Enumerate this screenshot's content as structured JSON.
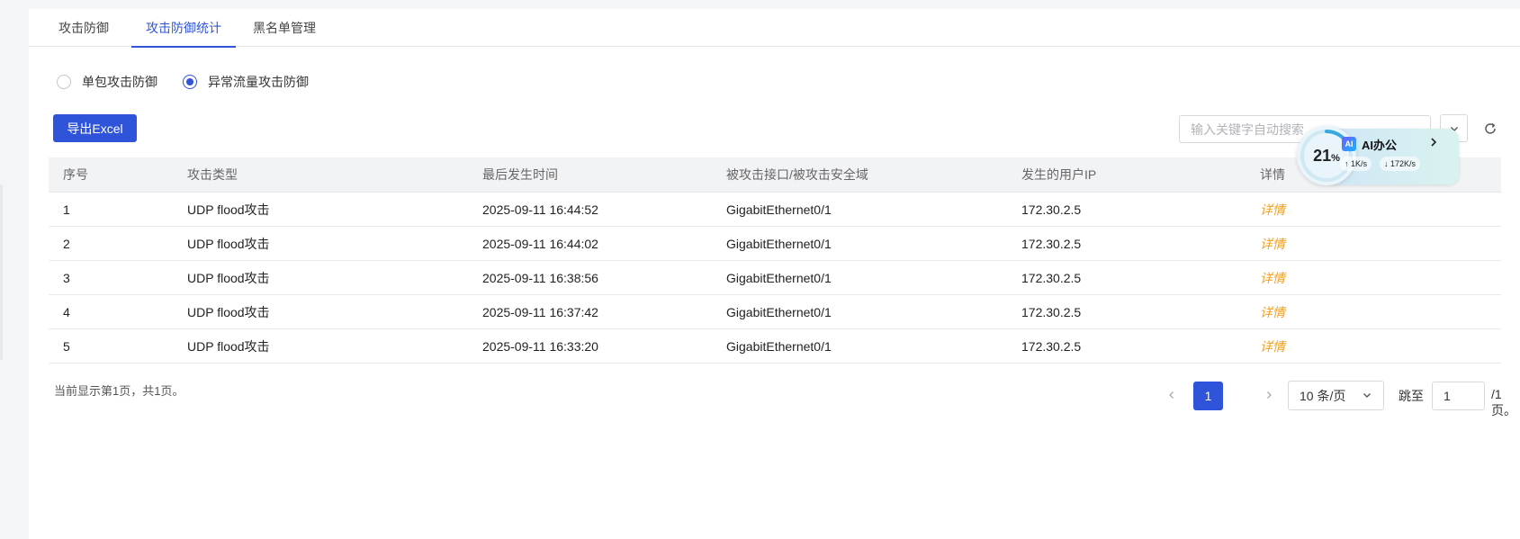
{
  "tabs": [
    {
      "label": "攻击防御"
    },
    {
      "label": "攻击防御统计"
    },
    {
      "label": "黑名单管理"
    }
  ],
  "radios": [
    {
      "label": "单包攻击防御",
      "selected": false
    },
    {
      "label": "异常流量攻击防御",
      "selected": true
    }
  ],
  "toolbar": {
    "export_label": "导出Excel",
    "search_placeholder": "输入关键字自动搜索"
  },
  "ai_widget": {
    "percent": "21",
    "percent_unit": "%",
    "title": "AI办公",
    "logo_text": "AI",
    "upload": "1K/s",
    "download": "172K/s"
  },
  "table": {
    "headers": [
      "序号",
      "攻击类型",
      "最后发生时间",
      "被攻击接口/被攻击安全域",
      "发生的用户IP",
      "详情"
    ],
    "rows": [
      [
        "1",
        "UDP flood攻击",
        "2025-09-11 16:44:52",
        "GigabitEthernet0/1",
        "172.30.2.5",
        "详情"
      ],
      [
        "2",
        "UDP flood攻击",
        "2025-09-11 16:44:02",
        "GigabitEthernet0/1",
        "172.30.2.5",
        "详情"
      ],
      [
        "3",
        "UDP flood攻击",
        "2025-09-11 16:38:56",
        "GigabitEthernet0/1",
        "172.30.2.5",
        "详情"
      ],
      [
        "4",
        "UDP flood攻击",
        "2025-09-11 16:37:42",
        "GigabitEthernet0/1",
        "172.30.2.5",
        "详情"
      ],
      [
        "5",
        "UDP flood攻击",
        "2025-09-11 16:33:20",
        "GigabitEthernet0/1",
        "172.30.2.5",
        "详情"
      ]
    ]
  },
  "pagination": {
    "summary": "当前显示第1页，共1页。",
    "current_page": "1",
    "page_size": "10 条/页",
    "jump_label": "跳至",
    "jump_value": "1",
    "total_suffix": "/1页。"
  },
  "colors": {
    "accent": "#2f54d9",
    "detail_link": "#f0a020"
  }
}
